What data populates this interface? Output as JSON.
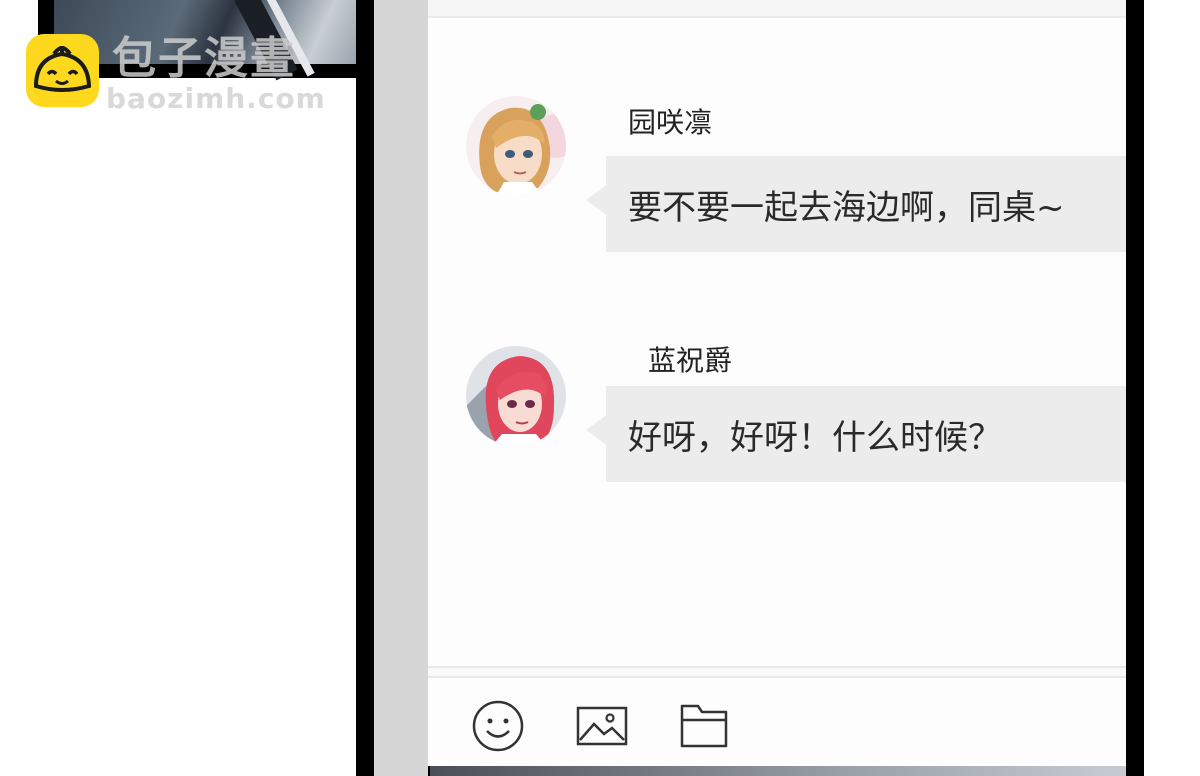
{
  "watermark": {
    "title": "包子漫畫",
    "url": "baozimh.com"
  },
  "chat": {
    "messages": [
      {
        "sender": "园咲凛",
        "text": "要不要一起去海边啊，同桌~",
        "avatar": "blonde-girl-avatar"
      },
      {
        "sender": "蓝祝爵",
        "text": "好呀，好呀！什么时候？",
        "avatar": "red-hair-girl-avatar"
      }
    ]
  },
  "toolbar": {
    "icons": [
      "emoji-icon",
      "image-icon",
      "folder-icon"
    ]
  },
  "colors": {
    "bubble": "#ececec",
    "logo": "#fdd81c",
    "frame": "#000000"
  }
}
